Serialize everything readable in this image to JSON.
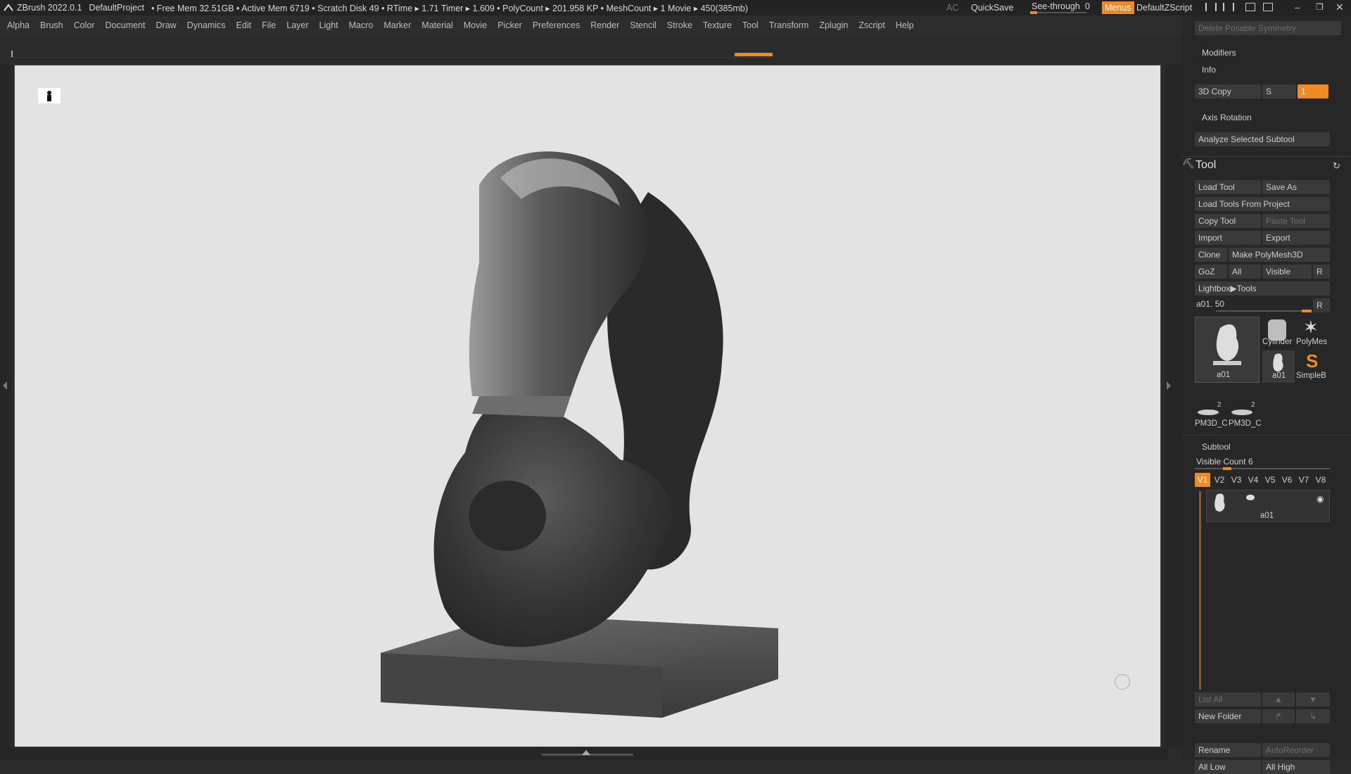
{
  "titlebar": {
    "app": "ZBrush 2022.0.1",
    "project": "DefaultProject",
    "stats": "• Free Mem 32.51GB • Active Mem 6719 • Scratch Disk 49 •  RTime ▸ 1.71 Timer ▸ 1.609 • PolyCount ▸ 201.958 KP  • MeshCount ▸ 1  Movie ▸ 450(385mb)",
    "ac": "AC",
    "quicksave": "QuickSave",
    "seethrough": "See-through",
    "seethrough_value": "0",
    "menus": "Menus",
    "zscript": "DefaultZScript"
  },
  "menubar": [
    "Alpha",
    "Brush",
    "Color",
    "Document",
    "Draw",
    "Dynamics",
    "Edit",
    "File",
    "Layer",
    "Light",
    "Macro",
    "Marker",
    "Material",
    "Movie",
    "Picker",
    "Preferences",
    "Render",
    "Stencil",
    "Stroke",
    "Texture",
    "Tool",
    "Transform",
    "Zplugin",
    "Zscript",
    "Help"
  ],
  "panel": {
    "delete_posable": "Delete Posable Symmetry",
    "modifiers": "Modifiers",
    "info": "Info",
    "copy3d": "3D Copy",
    "s_label": "S",
    "s_value": "1",
    "axis_rotation": "Axis Rotation",
    "analyze": "Analyze Selected Subtool",
    "tool_title": "Tool",
    "load_tool": "Load Tool",
    "save_as": "Save As",
    "load_from_project": "Load Tools From Project",
    "copy_tool": "Copy Tool",
    "paste_tool": "Paste Tool",
    "import": "Import",
    "export": "Export",
    "clone": "Clone",
    "make_polymesh": "Make PolyMesh3D",
    "goz": "GoZ",
    "all": "All",
    "visible": "Visible",
    "r": "R",
    "lightbox": "Lightbox▶Tools",
    "slider_label": "a01. 50",
    "thumbs": {
      "main": "a01",
      "cylinder": "Cylinder",
      "polymesh": "PolyMes",
      "a01_small": "a01",
      "simpleb": "SimpleB",
      "pm1": "PM3D_C",
      "pm2": "PM3D_C",
      "pm_badge": "2"
    },
    "subtool": "Subtool",
    "visible_count": "Visible Count 6",
    "vtabs": [
      "V1",
      "V2",
      "V3",
      "V4",
      "V5",
      "V6",
      "V7",
      "V8"
    ],
    "subtool_item": "a01",
    "list_all": "List All",
    "new_folder": "New Folder",
    "rename": "Rename",
    "autoreorder": "AutoReorder",
    "all_low": "All Low",
    "all_high": "All High"
  },
  "colors": {
    "accent": "#f08a24",
    "canvas": "#e3e3e3",
    "panel": "#272727"
  }
}
